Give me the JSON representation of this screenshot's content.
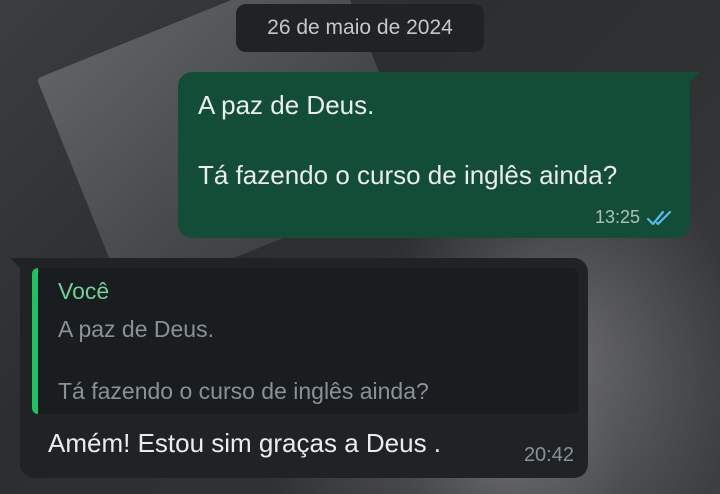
{
  "date_chip": "26 de maio de 2024",
  "outgoing": {
    "line1": "A paz de Deus.",
    "line2": "Tá fazendo o curso de inglês ainda?",
    "time": "13:25",
    "status_icon": "double-check-icon",
    "tick_color": "#53bdeb"
  },
  "incoming": {
    "quote": {
      "author": "Você",
      "line1": "A paz de Deus.",
      "line2": "Tá fazendo o curso de inglês ainda?"
    },
    "text": "Amém! Estou sim graças a Deus .",
    "time": "20:42"
  },
  "colors": {
    "outgoing_bubble": "#144d37",
    "incoming_bubble": "#1f2326",
    "quote_bar": "#21c063",
    "quote_author": "#6fcf97"
  }
}
